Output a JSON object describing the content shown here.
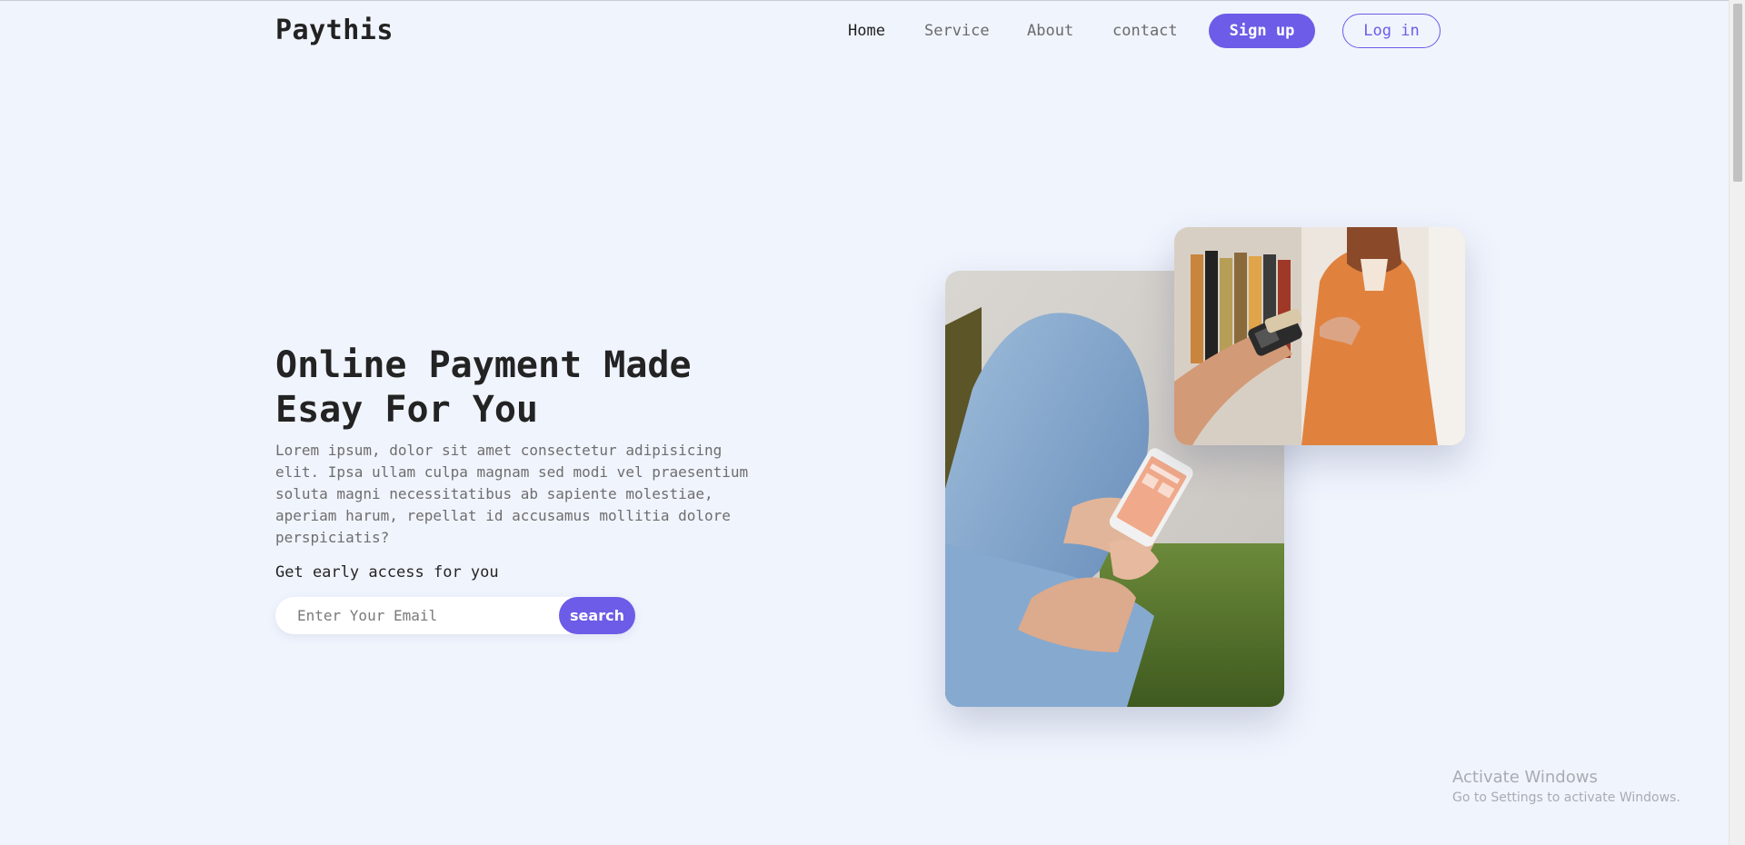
{
  "brand": {
    "logo": "Paythis",
    "accent": "#6c5ce7"
  },
  "nav": {
    "items": [
      {
        "label": "Home",
        "active": true
      },
      {
        "label": "Service"
      },
      {
        "label": "About"
      },
      {
        "label": "contact"
      }
    ],
    "signup_label": "Sign up",
    "login_label": "Log in"
  },
  "hero": {
    "title": "Online Payment Made Esay For You",
    "description": "Lorem ipsum, dolor sit amet consectetur adipisicing elit. Ipsa ullam culpa magnam sed modi vel praesentium soluta magni necessitatibus ab sapiente molestiae, aperiam harum, repellat id accusamus mollitia dolore perspiciatis?",
    "access_label": "Get early access for you",
    "email_placeholder": "Enter Your Email",
    "search_label": "search"
  },
  "watermark": {
    "title": "Activate Windows",
    "subtitle": "Go to Settings to activate Windows."
  }
}
